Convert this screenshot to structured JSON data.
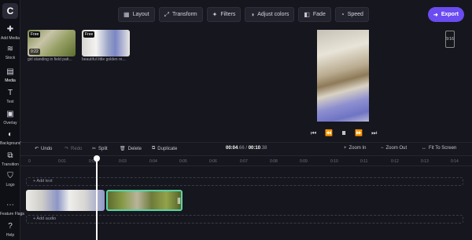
{
  "sidebar": {
    "logo": "C",
    "items": [
      {
        "label": "Add Media",
        "icon": "plus-icon"
      },
      {
        "label": "Stock",
        "icon": "database-icon"
      },
      {
        "label": "Media",
        "icon": "file-icon"
      },
      {
        "label": "Text",
        "icon": "text-icon"
      },
      {
        "label": "Overlay",
        "icon": "layers-icon"
      },
      {
        "label": "Background",
        "icon": "palette-icon"
      },
      {
        "label": "Transition",
        "icon": "transition-icon"
      },
      {
        "label": "Logo",
        "icon": "shield-icon"
      },
      {
        "label": "Feature Flags",
        "icon": "more-icon"
      },
      {
        "label": "Help",
        "icon": "help-icon"
      }
    ]
  },
  "toolbar": {
    "buttons": [
      {
        "label": "Layout",
        "icon": "layout-icon"
      },
      {
        "label": "Transform",
        "icon": "transform-icon"
      },
      {
        "label": "Filters",
        "icon": "sparkle-icon"
      },
      {
        "label": "Adjust colors",
        "icon": "adjust-icon"
      },
      {
        "label": "Fade",
        "icon": "fade-icon"
      },
      {
        "label": "Speed",
        "icon": "speed-icon"
      }
    ],
    "export_label": "Export"
  },
  "media": [
    {
      "badge": "Free",
      "duration": "0:22",
      "caption": "girl standing in field patt..."
    },
    {
      "badge": "Free",
      "duration": "",
      "caption": "beautiful little golden re..."
    }
  ],
  "preview": {
    "aspect_ratio": "9:16"
  },
  "edit_bar": {
    "undo": "Undo",
    "redo": "Redo",
    "split": "Split",
    "delete": "Delete",
    "duplicate": "Duplicate",
    "time_current": "00:04",
    "time_current_frac": ".66",
    "separator": " / ",
    "time_total": "00:10",
    "time_total_frac": ".38",
    "zoom_in": "Zoom In",
    "zoom_out": "Zoom Out",
    "fit": "Fit To Screen"
  },
  "ruler": {
    "ticks": [
      "0",
      "0:01",
      "0:02",
      "0:03",
      "0:04",
      "0:05",
      "0:06",
      "0:07",
      "0:08",
      "0:09",
      "0:10",
      "0:11",
      "0:12",
      "0:13",
      "0:14"
    ]
  },
  "tracks": {
    "text_label": "+ Add text",
    "audio_label": "+ Add audio"
  },
  "colors": {
    "accent": "#6a4cf0",
    "selection": "#59d2a8"
  }
}
